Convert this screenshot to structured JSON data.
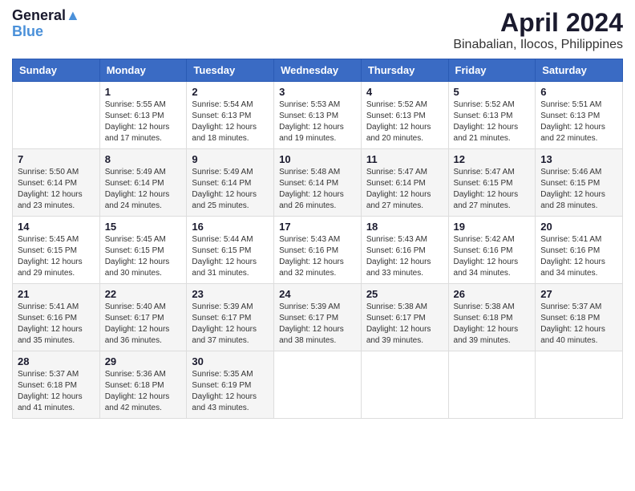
{
  "header": {
    "logo_line1": "General",
    "logo_line2": "Blue",
    "month_title": "April 2024",
    "location": "Binabalian, Ilocos, Philippines"
  },
  "calendar": {
    "headers": [
      "Sunday",
      "Monday",
      "Tuesday",
      "Wednesday",
      "Thursday",
      "Friday",
      "Saturday"
    ],
    "weeks": [
      [
        {
          "day": "",
          "info": ""
        },
        {
          "day": "1",
          "info": "Sunrise: 5:55 AM\nSunset: 6:13 PM\nDaylight: 12 hours\nand 17 minutes."
        },
        {
          "day": "2",
          "info": "Sunrise: 5:54 AM\nSunset: 6:13 PM\nDaylight: 12 hours\nand 18 minutes."
        },
        {
          "day": "3",
          "info": "Sunrise: 5:53 AM\nSunset: 6:13 PM\nDaylight: 12 hours\nand 19 minutes."
        },
        {
          "day": "4",
          "info": "Sunrise: 5:52 AM\nSunset: 6:13 PM\nDaylight: 12 hours\nand 20 minutes."
        },
        {
          "day": "5",
          "info": "Sunrise: 5:52 AM\nSunset: 6:13 PM\nDaylight: 12 hours\nand 21 minutes."
        },
        {
          "day": "6",
          "info": "Sunrise: 5:51 AM\nSunset: 6:13 PM\nDaylight: 12 hours\nand 22 minutes."
        }
      ],
      [
        {
          "day": "7",
          "info": "Sunrise: 5:50 AM\nSunset: 6:14 PM\nDaylight: 12 hours\nand 23 minutes."
        },
        {
          "day": "8",
          "info": "Sunrise: 5:49 AM\nSunset: 6:14 PM\nDaylight: 12 hours\nand 24 minutes."
        },
        {
          "day": "9",
          "info": "Sunrise: 5:49 AM\nSunset: 6:14 PM\nDaylight: 12 hours\nand 25 minutes."
        },
        {
          "day": "10",
          "info": "Sunrise: 5:48 AM\nSunset: 6:14 PM\nDaylight: 12 hours\nand 26 minutes."
        },
        {
          "day": "11",
          "info": "Sunrise: 5:47 AM\nSunset: 6:14 PM\nDaylight: 12 hours\nand 27 minutes."
        },
        {
          "day": "12",
          "info": "Sunrise: 5:47 AM\nSunset: 6:15 PM\nDaylight: 12 hours\nand 27 minutes."
        },
        {
          "day": "13",
          "info": "Sunrise: 5:46 AM\nSunset: 6:15 PM\nDaylight: 12 hours\nand 28 minutes."
        }
      ],
      [
        {
          "day": "14",
          "info": "Sunrise: 5:45 AM\nSunset: 6:15 PM\nDaylight: 12 hours\nand 29 minutes."
        },
        {
          "day": "15",
          "info": "Sunrise: 5:45 AM\nSunset: 6:15 PM\nDaylight: 12 hours\nand 30 minutes."
        },
        {
          "day": "16",
          "info": "Sunrise: 5:44 AM\nSunset: 6:15 PM\nDaylight: 12 hours\nand 31 minutes."
        },
        {
          "day": "17",
          "info": "Sunrise: 5:43 AM\nSunset: 6:16 PM\nDaylight: 12 hours\nand 32 minutes."
        },
        {
          "day": "18",
          "info": "Sunrise: 5:43 AM\nSunset: 6:16 PM\nDaylight: 12 hours\nand 33 minutes."
        },
        {
          "day": "19",
          "info": "Sunrise: 5:42 AM\nSunset: 6:16 PM\nDaylight: 12 hours\nand 34 minutes."
        },
        {
          "day": "20",
          "info": "Sunrise: 5:41 AM\nSunset: 6:16 PM\nDaylight: 12 hours\nand 34 minutes."
        }
      ],
      [
        {
          "day": "21",
          "info": "Sunrise: 5:41 AM\nSunset: 6:16 PM\nDaylight: 12 hours\nand 35 minutes."
        },
        {
          "day": "22",
          "info": "Sunrise: 5:40 AM\nSunset: 6:17 PM\nDaylight: 12 hours\nand 36 minutes."
        },
        {
          "day": "23",
          "info": "Sunrise: 5:39 AM\nSunset: 6:17 PM\nDaylight: 12 hours\nand 37 minutes."
        },
        {
          "day": "24",
          "info": "Sunrise: 5:39 AM\nSunset: 6:17 PM\nDaylight: 12 hours\nand 38 minutes."
        },
        {
          "day": "25",
          "info": "Sunrise: 5:38 AM\nSunset: 6:17 PM\nDaylight: 12 hours\nand 39 minutes."
        },
        {
          "day": "26",
          "info": "Sunrise: 5:38 AM\nSunset: 6:18 PM\nDaylight: 12 hours\nand 39 minutes."
        },
        {
          "day": "27",
          "info": "Sunrise: 5:37 AM\nSunset: 6:18 PM\nDaylight: 12 hours\nand 40 minutes."
        }
      ],
      [
        {
          "day": "28",
          "info": "Sunrise: 5:37 AM\nSunset: 6:18 PM\nDaylight: 12 hours\nand 41 minutes."
        },
        {
          "day": "29",
          "info": "Sunrise: 5:36 AM\nSunset: 6:18 PM\nDaylight: 12 hours\nand 42 minutes."
        },
        {
          "day": "30",
          "info": "Sunrise: 5:35 AM\nSunset: 6:19 PM\nDaylight: 12 hours\nand 43 minutes."
        },
        {
          "day": "",
          "info": ""
        },
        {
          "day": "",
          "info": ""
        },
        {
          "day": "",
          "info": ""
        },
        {
          "day": "",
          "info": ""
        }
      ]
    ]
  }
}
